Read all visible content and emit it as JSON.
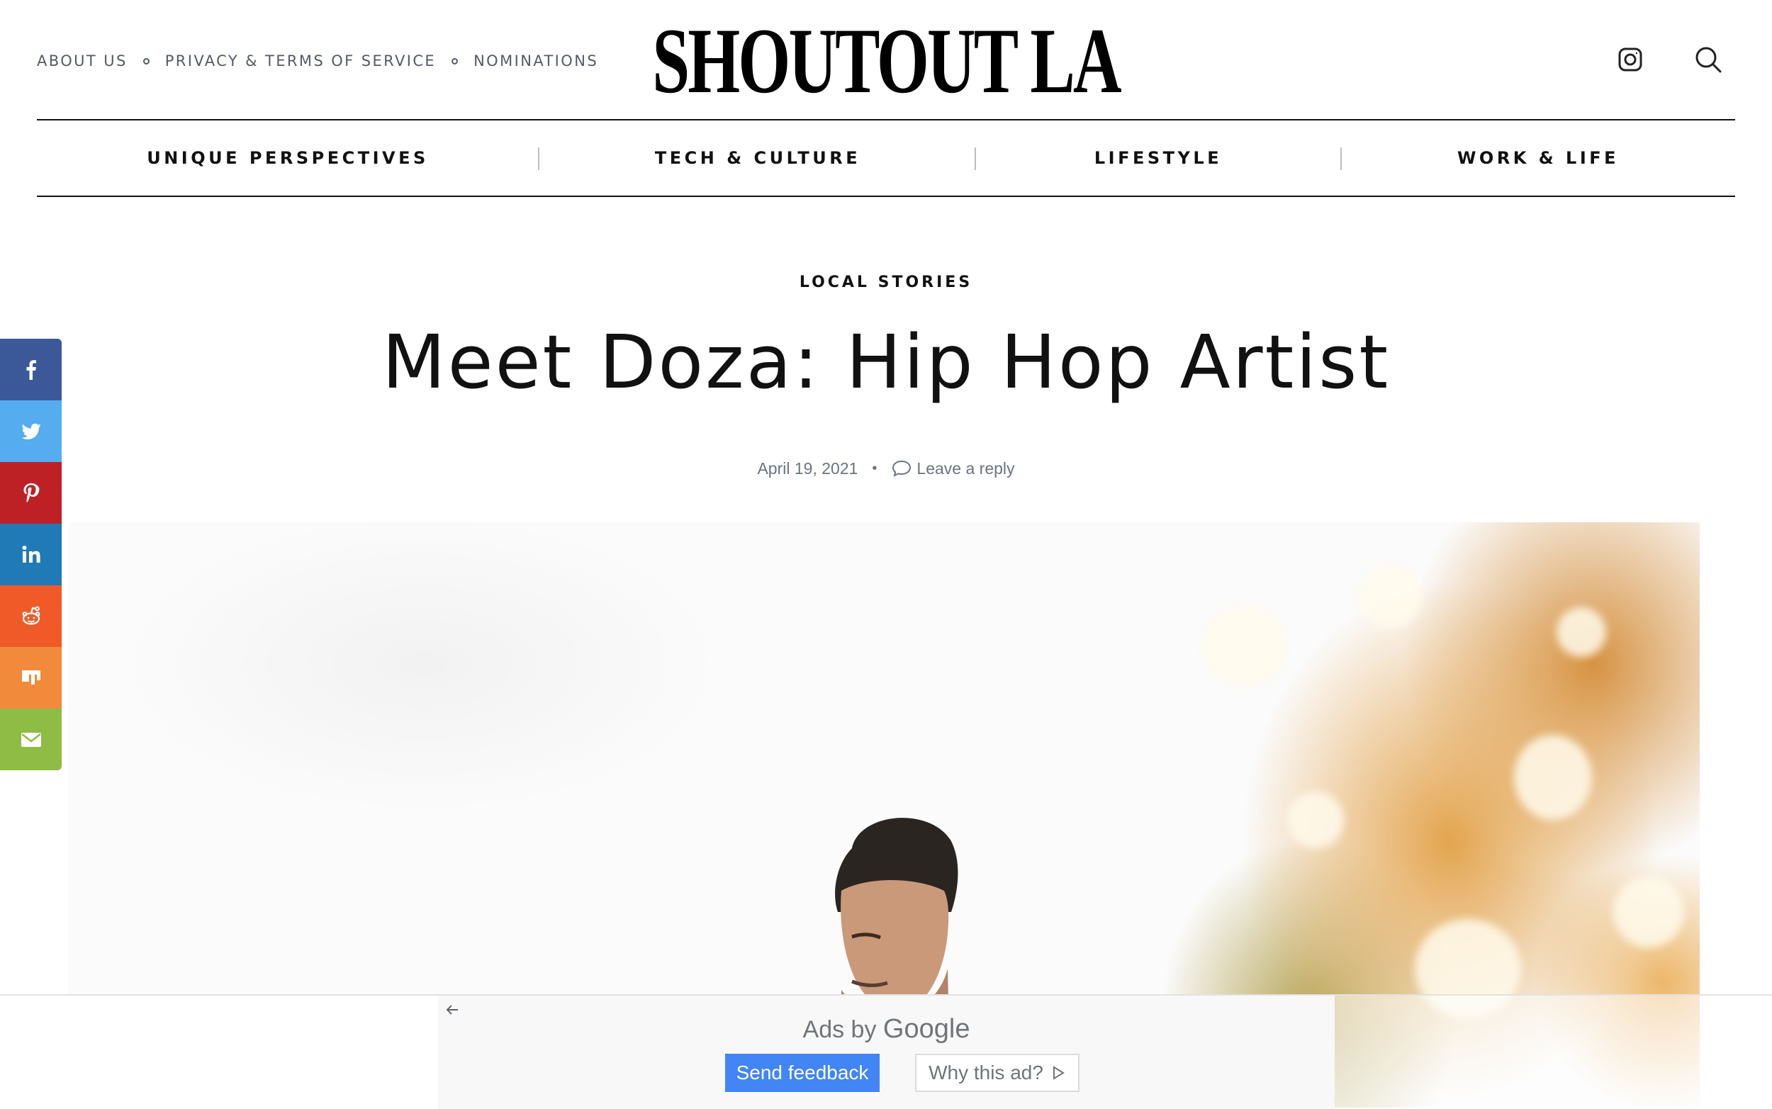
{
  "header": {
    "top_links": [
      "ABOUT US",
      "PRIVACY & TERMS OF SERVICE",
      "NOMINATIONS"
    ],
    "logo_text": "SHOUTOUT LA",
    "icons": [
      "instagram-icon",
      "search-icon"
    ]
  },
  "nav": {
    "items": [
      "UNIQUE PERSPECTIVES",
      "TECH & CULTURE",
      "LIFESTYLE",
      "WORK & LIFE"
    ]
  },
  "article": {
    "category": "LOCAL STORIES",
    "title": "Meet Doza: Hip Hop Artist",
    "date": "April 19, 2021",
    "reply_label": "Leave a reply",
    "meta_separator": "•"
  },
  "share_bar": {
    "buttons": [
      {
        "name": "facebook",
        "color": "#3b5998"
      },
      {
        "name": "twitter",
        "color": "#55acee"
      },
      {
        "name": "pinterest",
        "color": "#bd2126"
      },
      {
        "name": "linkedin",
        "color": "#1f7ab5"
      },
      {
        "name": "reddit",
        "color": "#f05a28"
      },
      {
        "name": "mix",
        "color": "#f18a3a"
      },
      {
        "name": "email",
        "color": "#8fbc45"
      }
    ]
  },
  "ad": {
    "ads_by_prefix": "Ads by",
    "ads_by_brand": "Google",
    "send_feedback": "Send feedback",
    "why_this_ad": "Why this ad?"
  },
  "colors": {
    "meta_text": "#6b7385",
    "google_blue": "#4285f4"
  }
}
